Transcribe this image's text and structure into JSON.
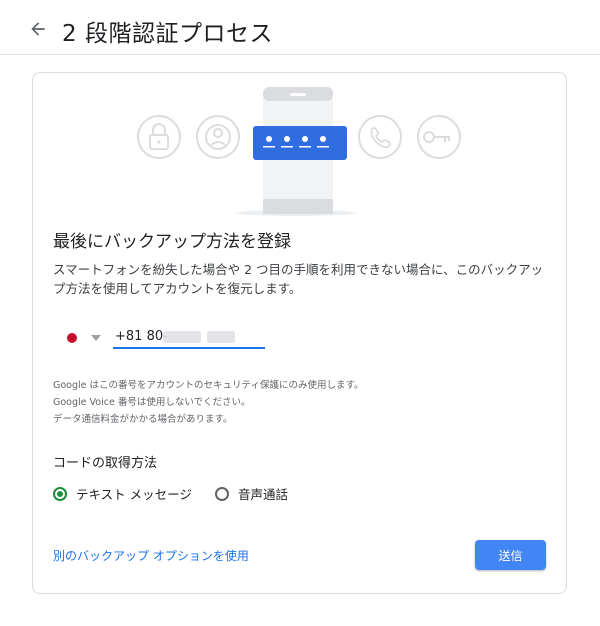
{
  "header": {
    "title": "2 段階認証プロセス",
    "back_icon": "arrow-back-icon"
  },
  "illustration": {
    "icons": [
      "lock-icon",
      "account-circle-icon",
      "phone-handset-icon",
      "key-icon"
    ],
    "pin_card": {
      "digits": 4,
      "color": "#2f6de1"
    }
  },
  "main": {
    "title": "最後にバックアップ方法を登録",
    "description": "スマートフォンを紛失した場合や 2 つ目の手順を利用できない場合に、このバックアップ方法を使用してアカウントを復元します。"
  },
  "phone": {
    "country_flag": "japan-flag-icon",
    "value": "+81 80-"
  },
  "notes": [
    "Google はこの番号をアカウントのセキュリティ保護にのみ使用します。",
    "Google Voice 番号は使用しないでください。",
    "データ通信料金がかかる場合があります。"
  ],
  "code_method": {
    "title": "コードの取得方法",
    "options": [
      {
        "label": "テキスト メッセージ",
        "selected": true
      },
      {
        "label": "音声通話",
        "selected": false
      }
    ]
  },
  "actions": {
    "alt_link": "別のバックアップ オプションを使用",
    "send_button": "送信"
  },
  "colors": {
    "accent": "#1a73e8",
    "button": "#4285f4",
    "radio_selected": "#1e8e3e"
  }
}
